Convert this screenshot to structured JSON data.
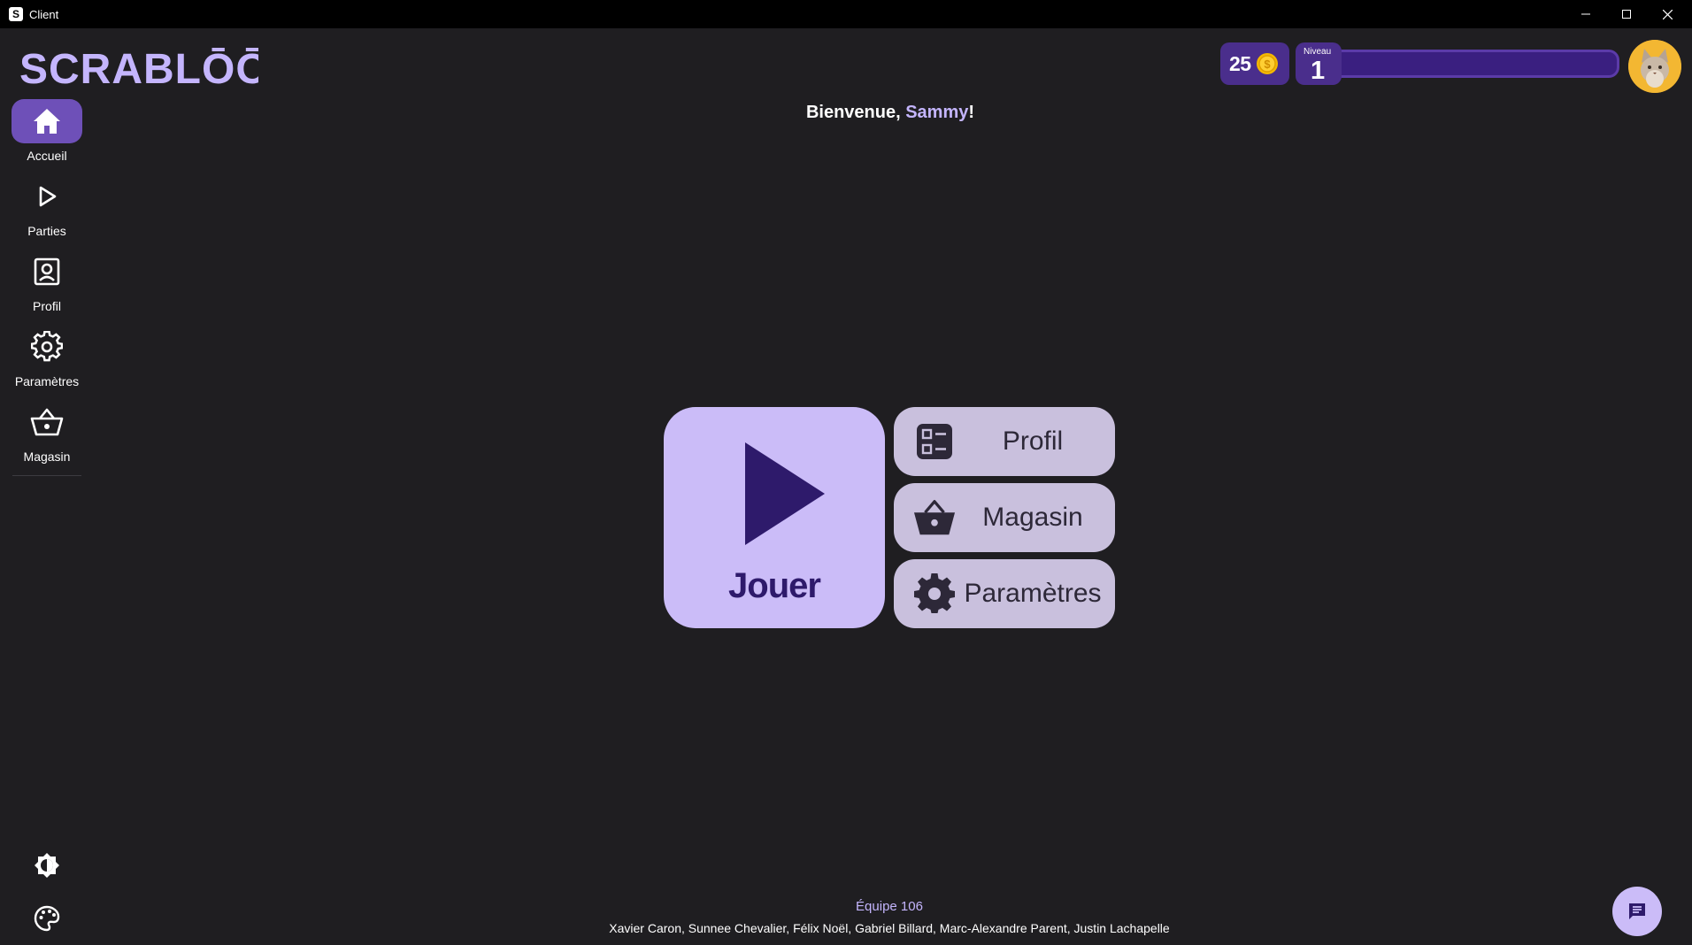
{
  "window": {
    "title": "Client",
    "app_icon_glyph": "S"
  },
  "header": {
    "logo_text": "SCRABLŌŌ",
    "coins": "25",
    "level_label": "Niveau",
    "level_value": "1",
    "xp_progress": 0.0,
    "welcome_prefix": "Bienvenue, ",
    "username": "Sammy",
    "welcome_suffix": "!"
  },
  "sidebar": {
    "items": [
      {
        "label": "Accueil",
        "icon": "home-icon",
        "active": true
      },
      {
        "label": "Parties",
        "icon": "play-icon",
        "active": false
      },
      {
        "label": "Profil",
        "icon": "profile-icon",
        "active": false
      },
      {
        "label": "Paramètres",
        "icon": "gear-icon",
        "active": false
      },
      {
        "label": "Magasin",
        "icon": "basket-icon",
        "active": false
      }
    ],
    "bottom_icons": [
      "brightness-icon",
      "palette-icon"
    ]
  },
  "main": {
    "play_label": "Jouer",
    "profile_label": "Profil",
    "shop_label": "Magasin",
    "settings_label": "Paramètres"
  },
  "footer": {
    "team": "Équipe 106",
    "members": "Xavier Caron, Sunnee Chevalier, Félix Noël, Gabriel Billard, Marc-Alexandre Parent, Justin Lachapelle"
  },
  "colors": {
    "background": "#1f1e21",
    "accent": "#6e50b8",
    "accent_light": "#cbbcf8",
    "accent_dark": "#2e1a6b",
    "highlight_text": "#c4b5fd"
  }
}
